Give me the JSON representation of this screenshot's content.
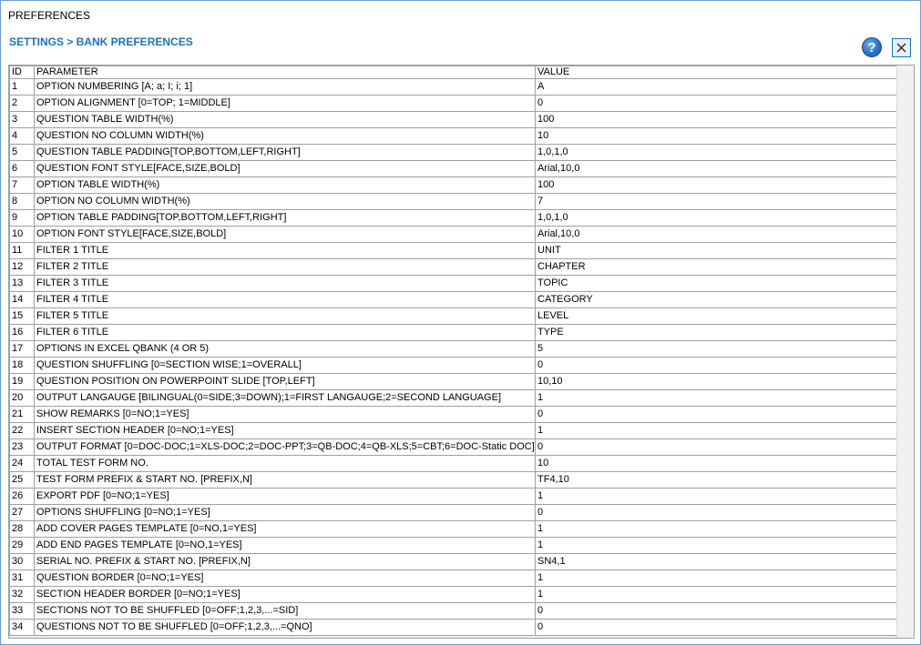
{
  "window": {
    "title": "PREFERENCES"
  },
  "breadcrumb": "SETTINGS > BANK PREFERENCES",
  "buttons": {
    "help_label": "?"
  },
  "columns": {
    "id": "ID",
    "parameter": "PARAMETER",
    "value": "VALUE"
  },
  "rows": [
    {
      "id": "1",
      "parameter": "OPTION NUMBERING [A; a; I; i; 1]",
      "value": "A"
    },
    {
      "id": "2",
      "parameter": "OPTION ALIGNMENT [0=TOP; 1=MIDDLE]",
      "value": "0"
    },
    {
      "id": "3",
      "parameter": "QUESTION TABLE WIDTH(%)",
      "value": "100"
    },
    {
      "id": "4",
      "parameter": "QUESTION NO COLUMN WIDTH(%)",
      "value": "10"
    },
    {
      "id": "5",
      "parameter": "QUESTION TABLE PADDING[TOP,BOTTOM,LEFT,RIGHT]",
      "value": "1,0,1,0"
    },
    {
      "id": "6",
      "parameter": "QUESTION FONT STYLE[FACE,SIZE,BOLD]",
      "value": "Arial,10,0"
    },
    {
      "id": "7",
      "parameter": "OPTION TABLE WIDTH(%)",
      "value": "100"
    },
    {
      "id": "8",
      "parameter": "OPTION NO COLUMN WIDTH(%)",
      "value": "7"
    },
    {
      "id": "9",
      "parameter": "OPTION TABLE PADDING[TOP,BOTTOM,LEFT,RIGHT]",
      "value": "1,0,1,0"
    },
    {
      "id": "10",
      "parameter": "OPTION FONT STYLE[FACE,SIZE,BOLD]",
      "value": "Arial,10,0"
    },
    {
      "id": "11",
      "parameter": "FILTER 1 TITLE",
      "value": "UNIT"
    },
    {
      "id": "12",
      "parameter": "FILTER 2 TITLE",
      "value": "CHAPTER"
    },
    {
      "id": "13",
      "parameter": "FILTER 3 TITLE",
      "value": "TOPIC"
    },
    {
      "id": "14",
      "parameter": "FILTER 4 TITLE",
      "value": "CATEGORY"
    },
    {
      "id": "15",
      "parameter": "FILTER 5 TITLE",
      "value": "LEVEL"
    },
    {
      "id": "16",
      "parameter": "FILTER 6 TITLE",
      "value": "TYPE"
    },
    {
      "id": "17",
      "parameter": "OPTIONS IN EXCEL QBANK (4 OR 5)",
      "value": "5"
    },
    {
      "id": "18",
      "parameter": "QUESTION SHUFFLING [0=SECTION WISE;1=OVERALL]",
      "value": "0"
    },
    {
      "id": "19",
      "parameter": "QUESTION POSITION ON POWERPOINT SLIDE [TOP,LEFT]",
      "value": "10,10"
    },
    {
      "id": "20",
      "parameter": "OUTPUT LANGAUGE [BILINGUAL(0=SIDE;3=DOWN);1=FIRST LANGAUGE;2=SECOND LANGUAGE]",
      "value": "1"
    },
    {
      "id": "21",
      "parameter": "SHOW REMARKS [0=NO;1=YES]",
      "value": "0"
    },
    {
      "id": "22",
      "parameter": "INSERT SECTION HEADER [0=NO;1=YES]",
      "value": "1"
    },
    {
      "id": "23",
      "parameter": "OUTPUT FORMAT [0=DOC-DOC;1=XLS-DOC;2=DOC-PPT;3=QB-DOC;4=QB-XLS;5=CBT;6=DOC-Static DOC]",
      "value": "0"
    },
    {
      "id": "24",
      "parameter": "TOTAL TEST FORM NO.",
      "value": "10"
    },
    {
      "id": "25",
      "parameter": "TEST FORM PREFIX & START NO. [PREFIX,N]",
      "value": "TF4,10"
    },
    {
      "id": "26",
      "parameter": "EXPORT PDF [0=NO;1=YES]",
      "value": "1"
    },
    {
      "id": "27",
      "parameter": "OPTIONS SHUFFLING [0=NO;1=YES]",
      "value": "0"
    },
    {
      "id": "28",
      "parameter": "ADD COVER PAGES TEMPLATE [0=NO,1=YES]",
      "value": "1"
    },
    {
      "id": "29",
      "parameter": "ADD END PAGES TEMPLATE [0=NO,1=YES]",
      "value": "1"
    },
    {
      "id": "30",
      "parameter": "SERIAL NO. PREFIX & START NO. [PREFIX,N]",
      "value": "SN4,1"
    },
    {
      "id": "31",
      "parameter": "QUESTION BORDER [0=NO;1=YES]",
      "value": "1"
    },
    {
      "id": "32",
      "parameter": "SECTION HEADER BORDER [0=NO;1=YES]",
      "value": "1"
    },
    {
      "id": "33",
      "parameter": "SECTIONS NOT TO BE SHUFFLED [0=OFF;1,2,3,...=SID]",
      "value": "0"
    },
    {
      "id": "34",
      "parameter": "QUESTIONS NOT TO BE SHUFFLED [0=OFF;1,2,3,...=QNO]",
      "value": "0"
    }
  ],
  "colors": {
    "accent": "#1b73b8",
    "border": "#6f9fcf"
  },
  "icons": {
    "help": "help-icon",
    "close": "close-icon"
  }
}
